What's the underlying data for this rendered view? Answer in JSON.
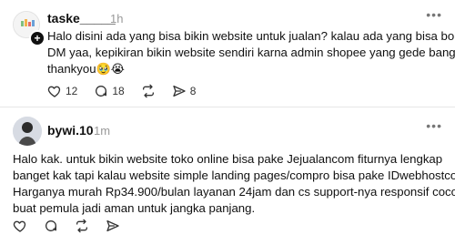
{
  "posts": [
    {
      "username": "taske_____",
      "time": "1h",
      "follow_badge": "+",
      "more": "•••",
      "text_lines": [
        "Halo disini ada yang bisa bikin website untuk jualan? kalau ada yang bisa boleh",
        "DM yaa, kepikiran bikin website sendiri karna admin shopee yang gede banget,",
        "thankyou"
      ],
      "emoji": "🥹😭",
      "likes": "12",
      "replies": "18",
      "shares": "8"
    },
    {
      "username": "bywi.10",
      "time": "1m",
      "more": "•••",
      "text_lines": [
        "Halo kak. untuk bikin website toko online bisa pake Jejualancom fiturnya lengkap",
        "banget kak tapi kalau website simple landing pages/compro bisa pake IDwebhostcom",
        "Harganya murah Rp34.900/bulan layanan 24jam dan cs support-nya responsif cocok",
        "buat pemula jadi aman untuk jangka panjang."
      ]
    }
  ],
  "icons": {
    "like": "heart-icon",
    "reply": "comment-icon",
    "repost": "repost-icon",
    "share": "send-icon",
    "more": "more-icon"
  }
}
